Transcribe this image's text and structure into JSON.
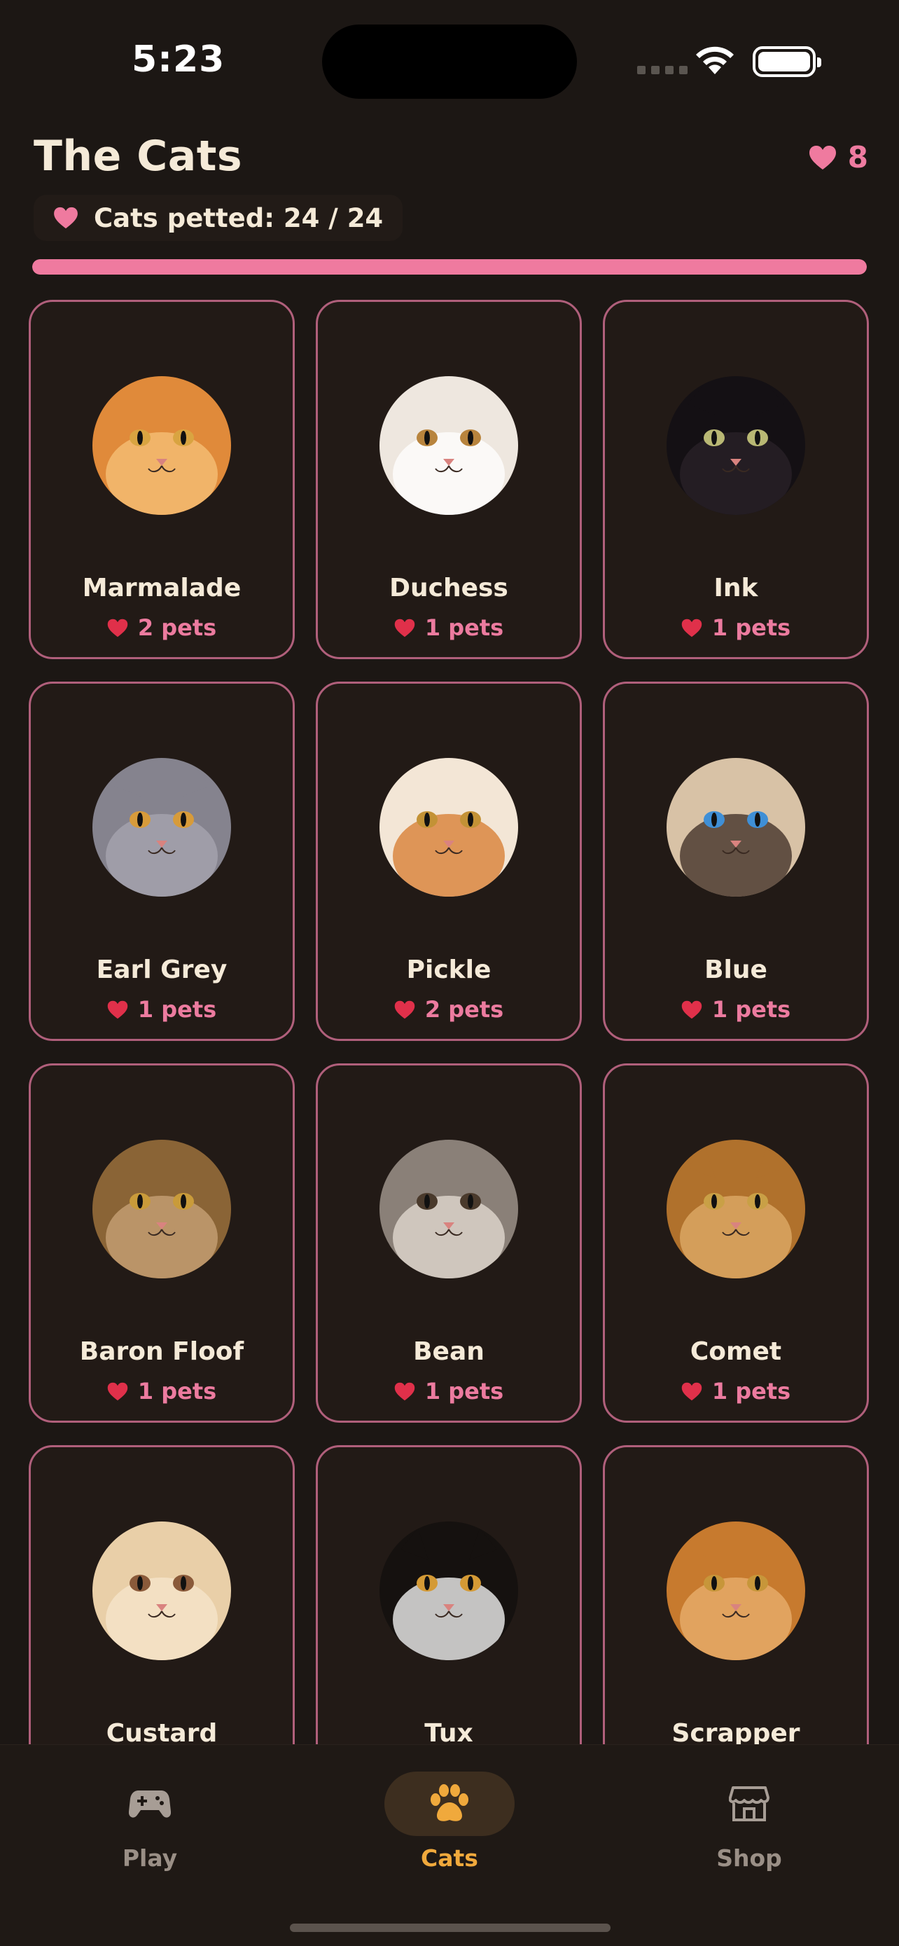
{
  "status_bar": {
    "time": "5:23"
  },
  "header": {
    "title": "The Cats",
    "total_hearts": "8",
    "petted_label": "Cats petted: 24 / 24",
    "progress_fraction": 1.0
  },
  "colors": {
    "accent_pink": "#ef7a9f",
    "accent_orange": "#f0a93c",
    "card_border": "#b05f7b"
  },
  "cats": [
    {
      "name": "Marmalade",
      "pets": "2 pets",
      "fur": "#e08a3a",
      "fur2": "#f7c27a",
      "eye": "#d9a441"
    },
    {
      "name": "Duchess",
      "pets": "1 pets",
      "fur": "#eee7df",
      "fur2": "#ffffff",
      "eye": "#b8843d"
    },
    {
      "name": "Ink",
      "pets": "1 pets",
      "fur": "#141014",
      "fur2": "#2a2228",
      "eye": "#b9b874"
    },
    {
      "name": "Earl Grey",
      "pets": "1 pets",
      "fur": "#85838e",
      "fur2": "#a8a6b0",
      "eye": "#d79b3a"
    },
    {
      "name": "Pickle",
      "pets": "2 pets",
      "fur": "#f3e6d6",
      "fur2": "#d77a2c",
      "eye": "#c39236"
    },
    {
      "name": "Blue",
      "pets": "1 pets",
      "fur": "#d8c2a6",
      "fur2": "#3b2a22",
      "eye": "#3f8fd6"
    },
    {
      "name": "Baron Floof",
      "pets": "1 pets",
      "fur": "#8a6436",
      "fur2": "#c9a47a",
      "eye": "#c99b3a"
    },
    {
      "name": "Bean",
      "pets": "1 pets",
      "fur": "#8a8078",
      "fur2": "#e6ded4",
      "eye": "#4a3a2c"
    },
    {
      "name": "Comet",
      "pets": "1 pets",
      "fur": "#b0712c",
      "fur2": "#e0ae6a",
      "eye": "#c9a046"
    },
    {
      "name": "Custard",
      "pets": "",
      "fur": "#e9cfa8",
      "fur2": "#f6e6cc",
      "eye": "#8a5a3a"
    },
    {
      "name": "Tux",
      "pets": "",
      "fur": "#15110f",
      "fur2": "#ffffff",
      "eye": "#d49a35"
    },
    {
      "name": "Scrapper",
      "pets": "",
      "fur": "#c77a2e",
      "fur2": "#eab270",
      "eye": "#c7963a"
    }
  ],
  "tabs": [
    {
      "label": "Play",
      "icon": "gamepad-icon",
      "active": false
    },
    {
      "label": "Cats",
      "icon": "paw-icon",
      "active": true
    },
    {
      "label": "Shop",
      "icon": "storefront-icon",
      "active": false
    }
  ]
}
